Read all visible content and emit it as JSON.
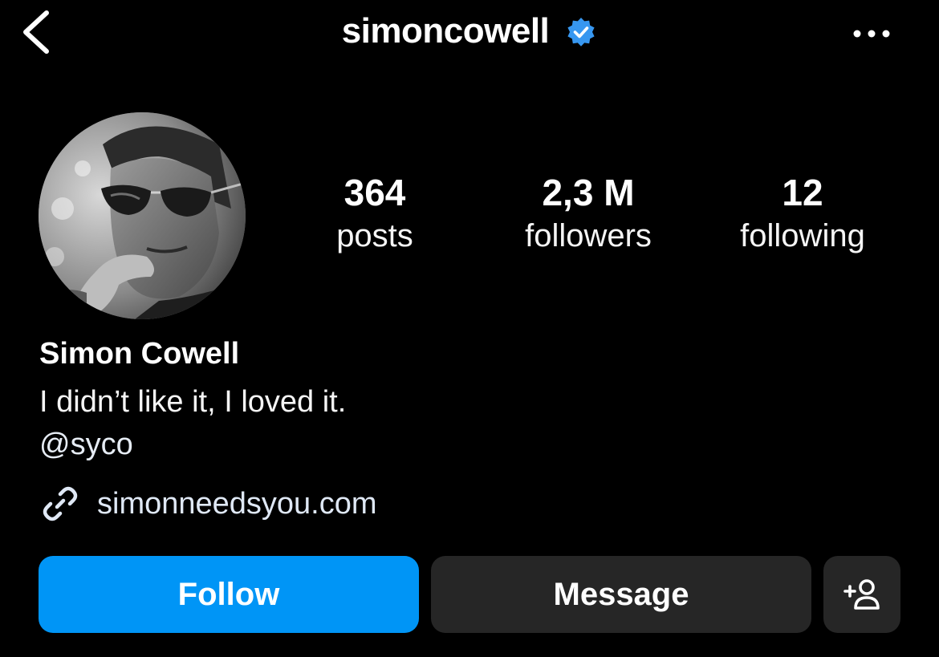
{
  "header": {
    "username": "simoncowell",
    "verified": true,
    "icons": {
      "back": "back-chevron-icon",
      "verified": "verified-badge-icon",
      "more": "more-horizontal-icon"
    }
  },
  "profile": {
    "avatar_icon": "profile-photo",
    "stats": [
      {
        "value": "364",
        "label": "posts"
      },
      {
        "value": "2,3 M",
        "label": "followers"
      },
      {
        "value": "12",
        "label": "following"
      }
    ],
    "display_name": "Simon Cowell",
    "bio": "I didn’t like it, I loved it.",
    "mention": "@syco",
    "link": {
      "icon": "link-icon",
      "text": "simonneedsyou.com"
    }
  },
  "actions": {
    "follow_label": "Follow",
    "message_label": "Message",
    "add_user_icon": "add-person-icon"
  },
  "colors": {
    "background": "#000000",
    "follow_button": "#0095f6",
    "secondary_button": "#262626",
    "verified_badge": "#3797f0"
  }
}
